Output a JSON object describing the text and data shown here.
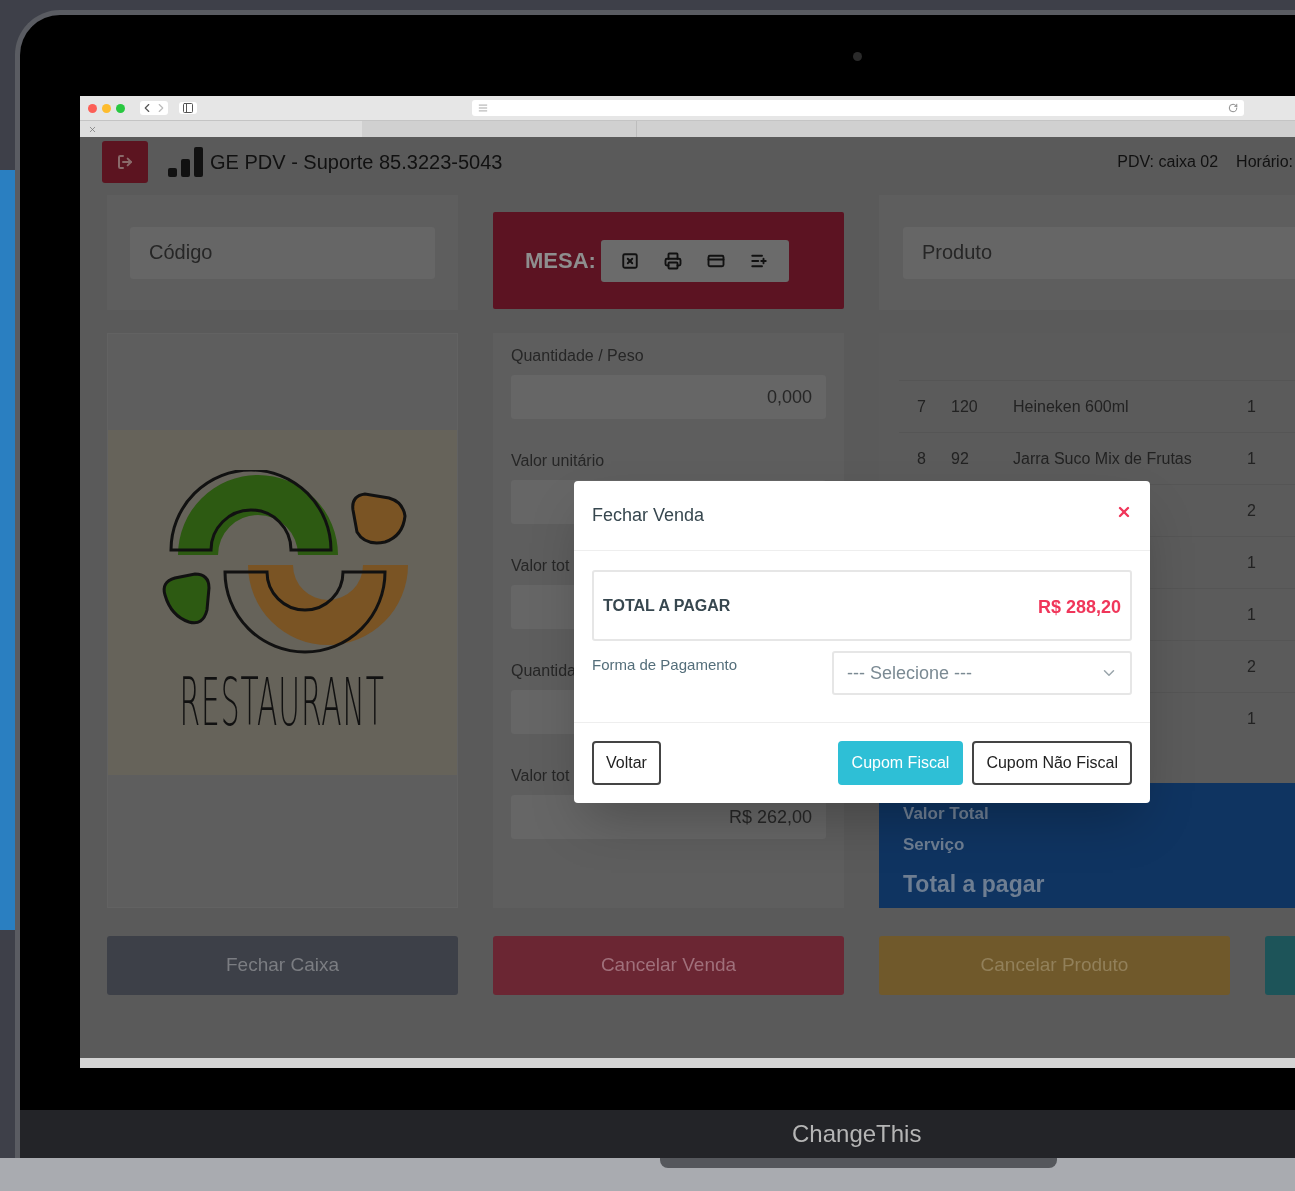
{
  "header": {
    "title": "GE PDV - Suporte 85.3223-5043",
    "pdv": "PDV: caixa 02",
    "time_label": "Horário:"
  },
  "code_field": {
    "placeholder": "Código"
  },
  "table_panel": {
    "label": "MESA:"
  },
  "product_field": {
    "placeholder": "Produto"
  },
  "logo": {
    "text": "RESTAURANT"
  },
  "item_form": {
    "fields": [
      {
        "label": "Quantidade / Peso",
        "value": "0,000"
      },
      {
        "label": "Valor unitário"
      },
      {
        "label": "Valor tot"
      },
      {
        "label": "Quantida"
      },
      {
        "label": "Valor tot",
        "value": "R$ 262,00"
      }
    ]
  },
  "items_table": {
    "rows": [
      {
        "number": "7",
        "code": "120",
        "product": "Heineken 600ml",
        "qty": "1"
      },
      {
        "number": "8",
        "code": "92",
        "product": "Jarra Suco Mix de Frutas",
        "qty": "1"
      },
      {
        "qty": "2"
      },
      {
        "qty": "1"
      },
      {
        "qty": "1"
      },
      {
        "qty": "2"
      },
      {
        "qty": "1"
      }
    ]
  },
  "totals": {
    "lines": [
      "Valor Total",
      "Serviço",
      "Total a pagar"
    ]
  },
  "actions": [
    {
      "label": "Fechar Caixa",
      "kind": "dark"
    },
    {
      "label": "Cancelar Venda",
      "kind": "danger"
    },
    {
      "label": "Cancelar Produto",
      "kind": "warning"
    },
    {
      "kind": "info"
    }
  ],
  "modal": {
    "title": "Fechar Venda",
    "total_label": "TOTAL A PAGAR",
    "total_value": "R$ 288,20",
    "payment_label": "Forma de Pagamento",
    "payment_select": {
      "placeholder": "--- Selecione ---"
    },
    "buttons": [
      {
        "label": "Voltar",
        "kind": "outline"
      },
      {
        "label": "Cupom Fiscal",
        "kind": "primary"
      },
      {
        "label": "Cupom Não Fiscal",
        "kind": "outline"
      }
    ]
  },
  "laptop": {
    "label": "ChangeThis"
  }
}
